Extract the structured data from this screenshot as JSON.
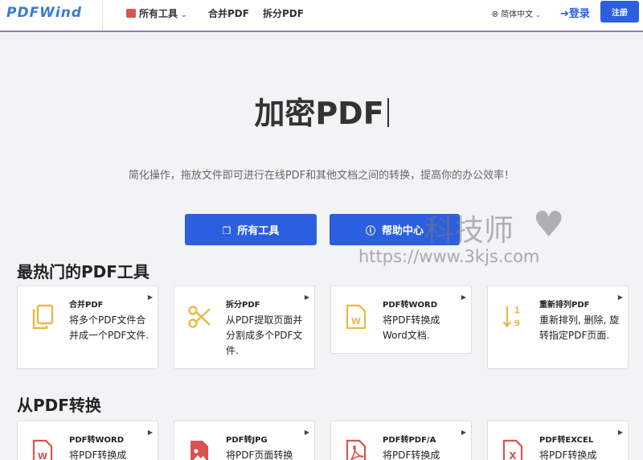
{
  "header": {
    "logo": "PDFWind",
    "nav": {
      "all_tools": "所有工具",
      "merge": "合并PDF",
      "split": "拆分PDF"
    },
    "language": "简体中文",
    "login": "登录",
    "signup": "注册"
  },
  "hero": {
    "title": "加密PDF",
    "subtitle": "简化操作，拖放文件即可进行在线PDF和其他文档之间的转换，提高你的办公效率！",
    "btn_all_tools": "所有工具",
    "btn_help": "帮助中心"
  },
  "watermark": {
    "text": "科技师",
    "heart": "♥",
    "url": "https://www.3kjs.com"
  },
  "sections": {
    "hot": {
      "title": "最热门的PDF工具",
      "cards": [
        {
          "title": "合并PDF",
          "desc": "将多个PDF文件合并成一个PDF文件."
        },
        {
          "title": "拆分PDF",
          "desc": "从PDF提取页面并分割成多个PDF文件."
        },
        {
          "title": "PDF转WORD",
          "desc": "将PDF转换成Word文档."
        },
        {
          "title": "重新排列PDF",
          "desc": "重新排列, 删除, 旋转指定PDF页面."
        }
      ]
    },
    "from_pdf": {
      "title": "从PDF转换",
      "cards": [
        {
          "title": "PDF转WORD",
          "desc": "将PDF转换成"
        },
        {
          "title": "PDF转JPG",
          "desc": "将PDF页面转换"
        },
        {
          "title": "PDF转PDF/A",
          "desc": "将PDF转换成"
        },
        {
          "title": "PDF转EXCEL",
          "desc": "将PDF转换成"
        }
      ]
    }
  },
  "colors": {
    "primary": "#2b5fe0",
    "icon_gold": "#e8b84a",
    "icon_red": "#d9534f"
  }
}
